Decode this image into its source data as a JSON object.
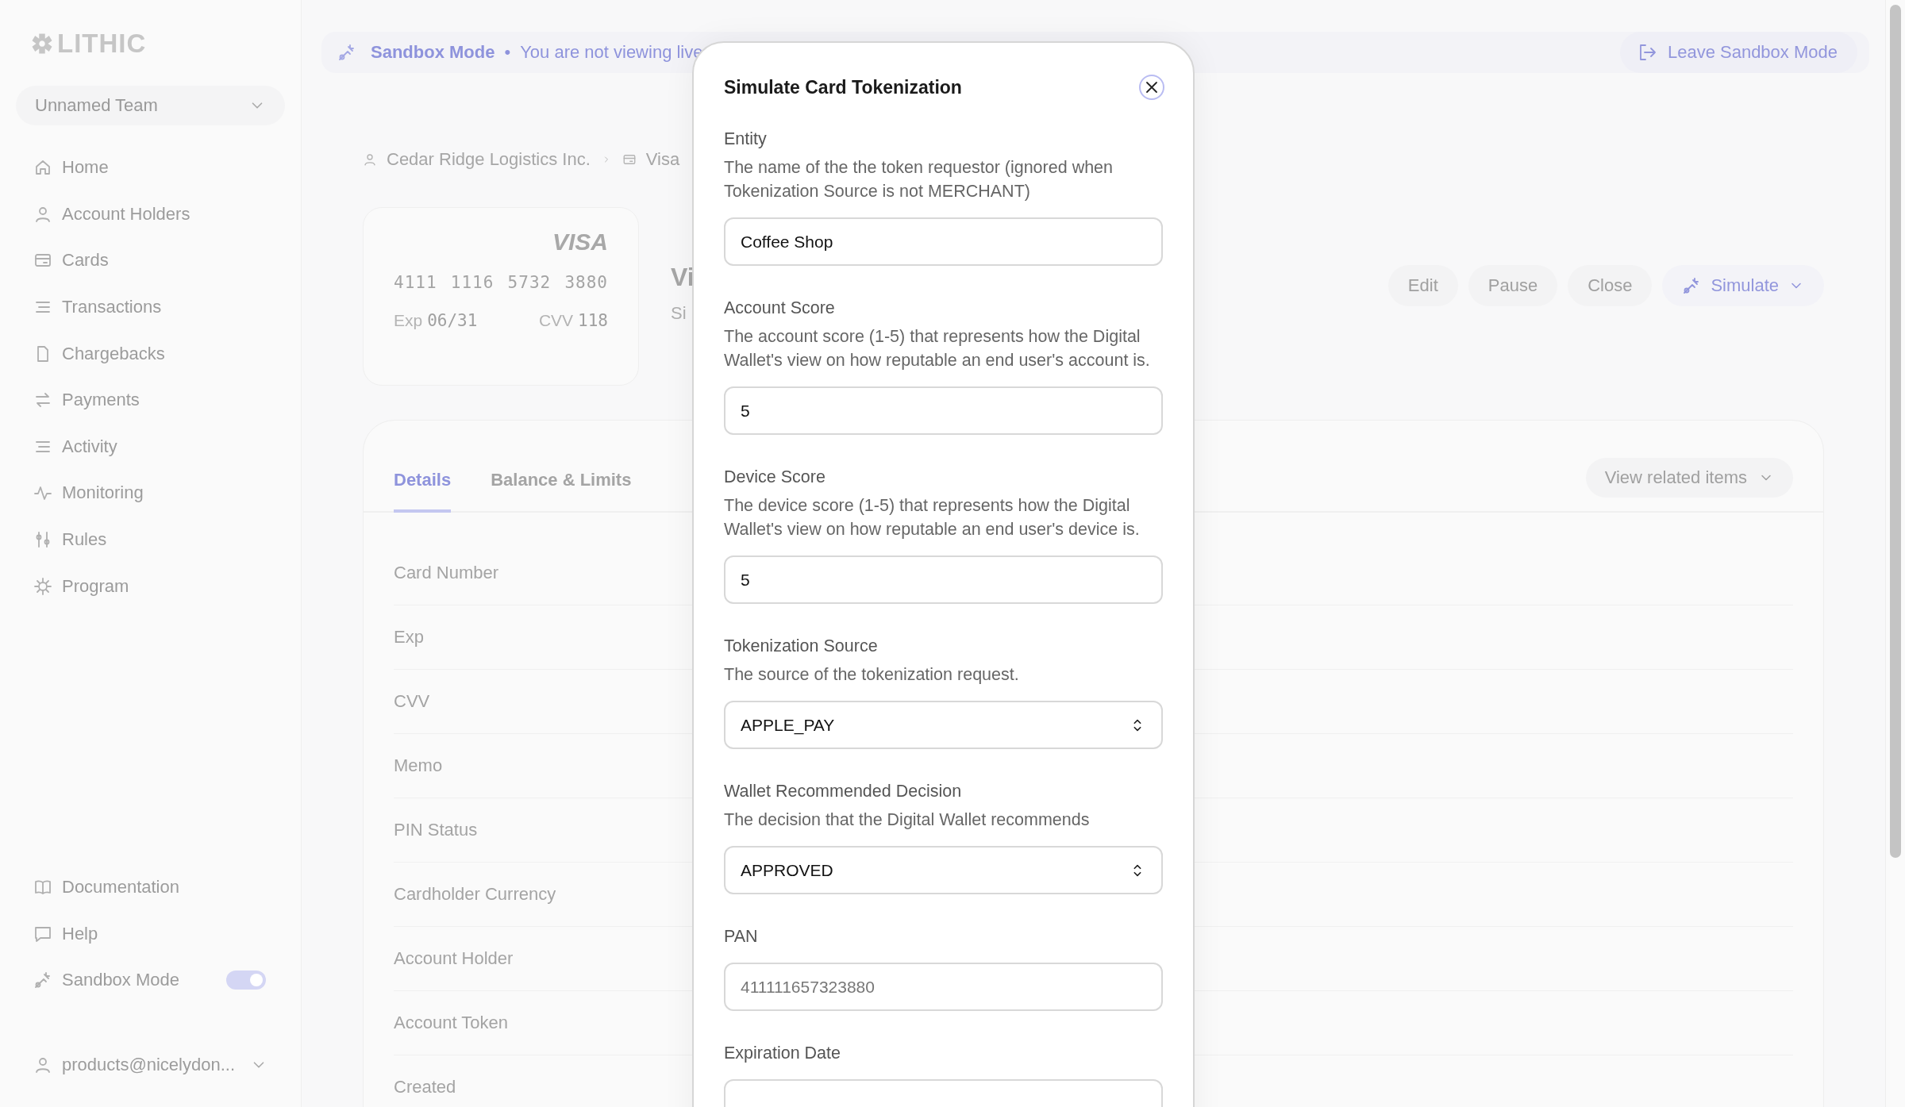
{
  "sidebar": {
    "logo": "LITHIC",
    "team": "Unnamed Team",
    "nav": [
      {
        "label": "Home"
      },
      {
        "label": "Account Holders"
      },
      {
        "label": "Cards"
      },
      {
        "label": "Transactions"
      },
      {
        "label": "Chargebacks"
      },
      {
        "label": "Payments"
      },
      {
        "label": "Activity"
      },
      {
        "label": "Monitoring"
      },
      {
        "label": "Rules"
      },
      {
        "label": "Program"
      }
    ],
    "footer": [
      {
        "label": "Documentation",
        "kind": "link"
      },
      {
        "label": "Help",
        "kind": "link"
      },
      {
        "label": "Sandbox Mode",
        "kind": "toggle",
        "on": true
      }
    ],
    "user": "products@nicelydon..."
  },
  "banner": {
    "title": "Sandbox Mode",
    "separator": "•",
    "message": "You are not viewing live",
    "action": "Leave Sandbox Mode"
  },
  "breadcrumb": [
    {
      "label": "Cedar Ridge Logistics Inc."
    },
    {
      "label": "Visa"
    }
  ],
  "card": {
    "brand": "VISA",
    "number_groups": [
      "4111",
      "1116",
      "5732",
      "3880"
    ],
    "exp_label": "Exp",
    "exp": "06/31",
    "cvv_label": "CVV",
    "cvv": "118"
  },
  "heading": {
    "title": "Vi",
    "subtitle": "Si"
  },
  "actions": [
    {
      "label": "Edit",
      "kind": "plain"
    },
    {
      "label": "Pause",
      "kind": "plain"
    },
    {
      "label": "Close",
      "kind": "plain"
    },
    {
      "label": "Simulate",
      "kind": "menu"
    }
  ],
  "details": {
    "tabs": [
      {
        "label": "Details",
        "selected": true
      },
      {
        "label": "Balance & Limits",
        "selected": false
      }
    ],
    "related": "View related items",
    "rows": [
      "Card Number",
      "Exp",
      "CVV",
      "Memo",
      "PIN Status",
      "Cardholder Currency",
      "Account Holder",
      "Account Token",
      "Created"
    ]
  },
  "modal": {
    "title": "Simulate Card Tokenization",
    "fields": [
      {
        "label": "Entity",
        "description": "The name of the the token requestor (ignored when Tokenization Source is not MERCHANT)",
        "kind": "text",
        "value": "Coffee Shop"
      },
      {
        "label": "Account Score",
        "description": "The account score (1-5) that represents how the Digital Wallet's view on how reputable an end user's account is.",
        "kind": "text",
        "value": "5"
      },
      {
        "label": "Device Score",
        "description": "The device score (1-5) that represents how the Digital Wallet's view on how reputable an end user's device is.",
        "kind": "text",
        "value": "5"
      },
      {
        "label": "Tokenization Source",
        "description": "The source of the tokenization request.",
        "kind": "select",
        "value": "APPLE_PAY"
      },
      {
        "label": "Wallet Recommended Decision",
        "description": "The decision that the Digital Wallet recommends",
        "kind": "select",
        "value": "APPROVED"
      },
      {
        "label": "PAN",
        "kind": "text",
        "placeholder": "411111657323880"
      },
      {
        "label": "Expiration Date",
        "kind": "text"
      }
    ]
  }
}
